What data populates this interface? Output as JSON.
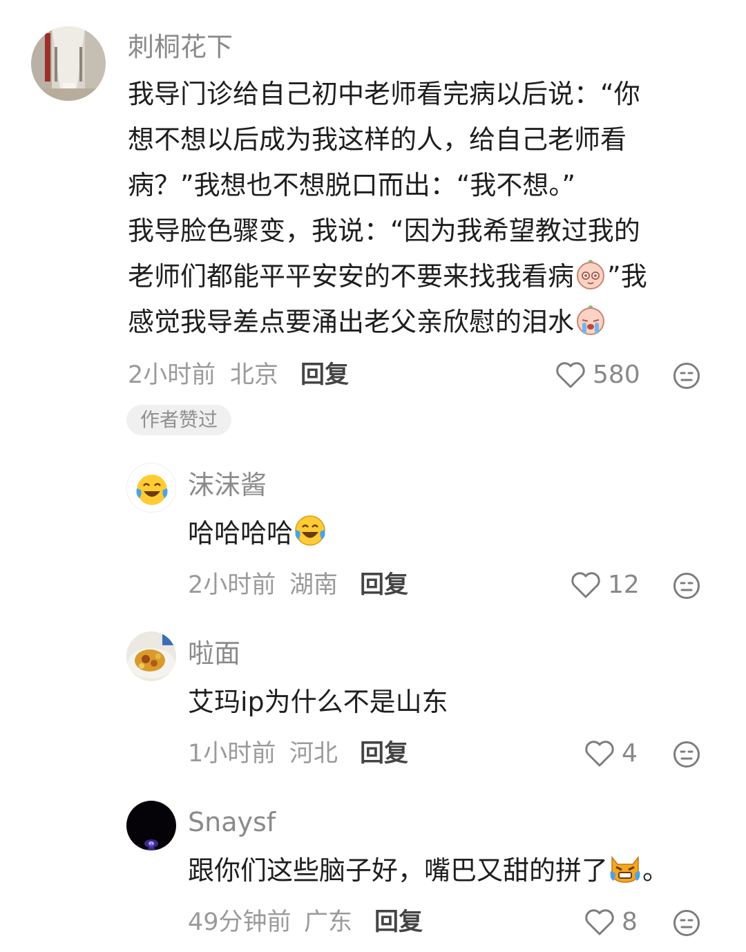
{
  "colors": {
    "name": "#8a8a8a",
    "text": "#1e1e1e",
    "meta": "#9a9a9a",
    "badge_bg": "#f0f0f0"
  },
  "comments": [
    {
      "author": "刺桐花下",
      "lines": [
        "我导门诊给自己初中老师看完病以后说：“你",
        "想不想以后成为我这样的人，给自己老师看",
        "病？”我想也不想脱口而出：“我不想。”",
        "我导脸色骤变，我说：“因为我希望教过我的",
        "老师们都能平平安安的不要来找我看病",
        "感觉我导差点要涌出老父亲欣慰的泪水"
      ],
      "line5_tail": "”我",
      "time": "2小时前",
      "location": "北京",
      "reply": "回复",
      "likes": "580",
      "badge": "作者赞过"
    },
    {
      "author": "沫沫酱",
      "text": "哈哈哈哈",
      "time": "2小时前",
      "location": "湖南",
      "reply": "回复",
      "likes": "12"
    },
    {
      "author": "啦面",
      "text": "艾玛ip为什么不是山东",
      "time": "1小时前",
      "location": "河北",
      "reply": "回复",
      "likes": "4"
    },
    {
      "author": "Snaysf",
      "text": "跟你们这些脑子好，嘴巴又甜的拼了",
      "text_tail": "。",
      "time": "49分钟前",
      "location": "广东",
      "reply": "回复",
      "likes": "8"
    }
  ]
}
